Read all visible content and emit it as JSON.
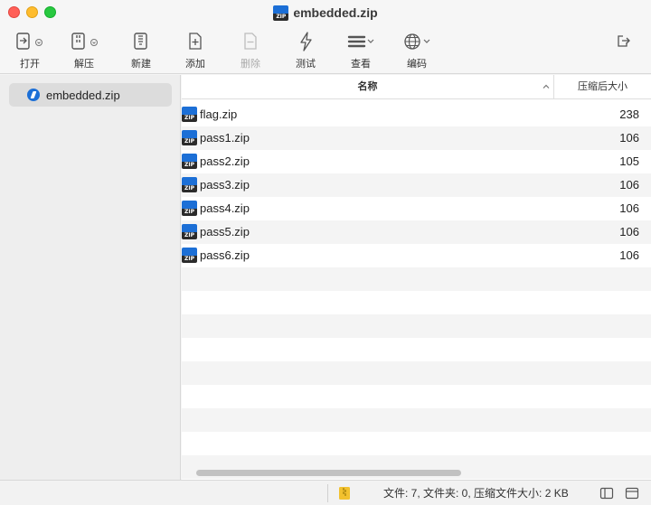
{
  "window": {
    "title": "embedded.zip"
  },
  "toolbar": {
    "open": "打开",
    "extract": "解压",
    "new": "新建",
    "add": "添加",
    "delete": "删除",
    "test": "测试",
    "view": "查看",
    "encoding": "编码"
  },
  "sidebar": {
    "items": [
      {
        "label": "embedded.zip"
      }
    ]
  },
  "list": {
    "columns": {
      "name": "名称",
      "size": "压缩后大小"
    },
    "rows": [
      {
        "name": "flag.zip",
        "size": "238"
      },
      {
        "name": "pass1.zip",
        "size": "106"
      },
      {
        "name": "pass2.zip",
        "size": "105"
      },
      {
        "name": "pass3.zip",
        "size": "106"
      },
      {
        "name": "pass4.zip",
        "size": "106"
      },
      {
        "name": "pass5.zip",
        "size": "106"
      },
      {
        "name": "pass6.zip",
        "size": "106"
      }
    ]
  },
  "status": {
    "text": "文件: 7, 文件夹: 0, 压缩文件大小: 2 KB"
  },
  "icons": {
    "zip_badge": "ZIP",
    "accent": "#1c6fd6"
  }
}
